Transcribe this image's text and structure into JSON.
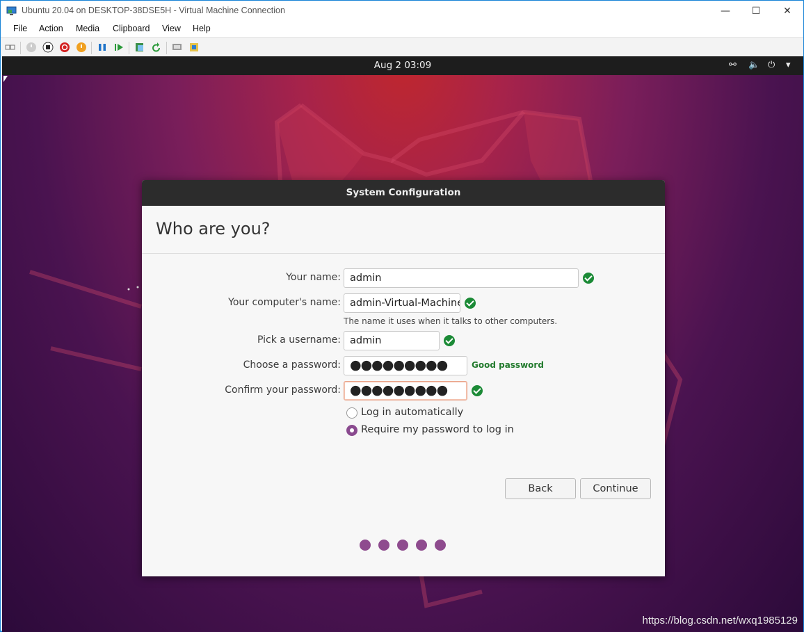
{
  "window": {
    "title": "Ubuntu 20.04 on DESKTOP-38DSE5H - Virtual Machine Connection",
    "controls": [
      "—",
      "☐",
      "✕"
    ]
  },
  "menu": [
    "File",
    "Action",
    "Media",
    "Clipboard",
    "View",
    "Help"
  ],
  "vm": {
    "clock": "Aug 2  03:09",
    "tray": {
      "network": "⚯",
      "volume": "🔈",
      "power": "⏻",
      "dropdown": "▾"
    }
  },
  "dialog": {
    "header": "System Configuration",
    "title": "Who are you?",
    "fields": {
      "name_label": "Your name:",
      "name_value": "admin",
      "computer_label": "Your computer's name:",
      "computer_value": "admin-Virtual-Machine",
      "computer_hint": "The name it uses when it talks to other computers.",
      "username_label": "Pick a username:",
      "username_value": "admin",
      "password_label": "Choose a password:",
      "password_value": "●●●●●●●●●",
      "password_strength": "Good password",
      "confirm_label": "Confirm your password:",
      "confirm_value": "●●●●●●●●●"
    },
    "options": {
      "auto_login": "Log in automatically",
      "require_password": "Require my password to log in",
      "selected": "require_password"
    },
    "buttons": {
      "back": "Back",
      "continue": "Continue"
    },
    "progress_steps": 5
  },
  "colors": {
    "accent": "#8e4b8e",
    "ok": "#1b8a36",
    "header": "#2c2c2c"
  },
  "watermark": "https://blog.csdn.net/wxq1985129"
}
